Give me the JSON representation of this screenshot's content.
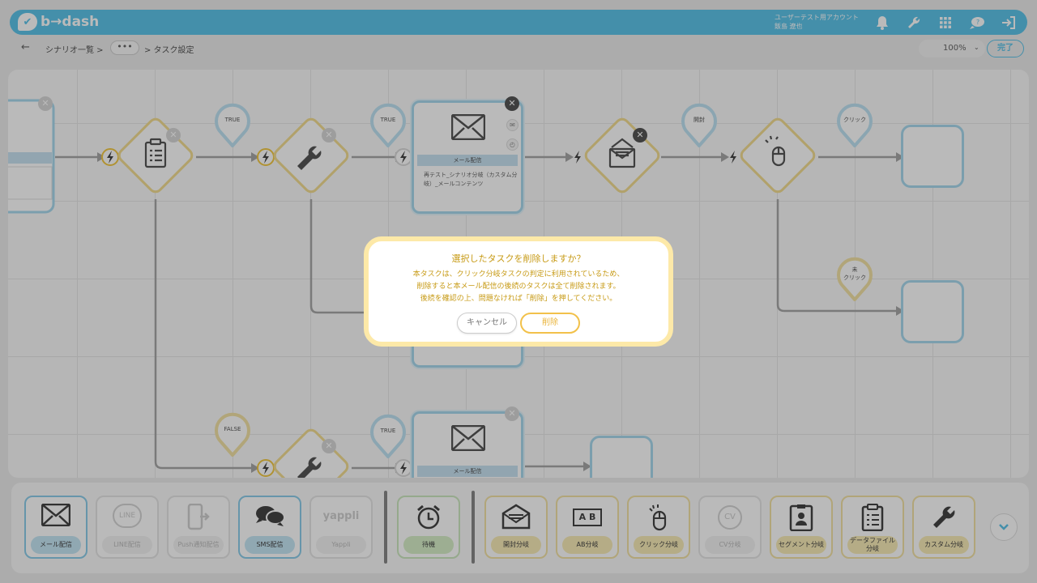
{
  "header": {
    "logo_text": "b→dash",
    "account_name": "ユーザーテスト用アカウント",
    "user_name": "飯島 遼也",
    "icons": [
      "bell-icon",
      "wrench-icon",
      "apps-grid-icon",
      "chat-icon",
      "logout-icon"
    ]
  },
  "breadcrumb": {
    "back": "←",
    "scenario_list": "シナリオ一覧 >",
    "more": "•••",
    "current": "> タスク設定"
  },
  "toolbar": {
    "zoom_value": "100%",
    "done_label": "完了"
  },
  "canvas": {
    "node1": {
      "label": "メール配信",
      "text": "再テスト_シナリオ分岐（カスタム分岐）_メールコンテンツ"
    },
    "node2": {
      "label": "メール配信"
    },
    "pins": {
      "true1": "TRUE",
      "true2": "TRUE",
      "open": "開封",
      "click": "クリック",
      "no_click_1": "未",
      "no_click_2": "クリック",
      "false": "FALSE",
      "true3": "TRUE"
    }
  },
  "palette": {
    "items": [
      {
        "label": "メール配信",
        "icon": "mail-icon",
        "state": "active"
      },
      {
        "label": "LINE配信",
        "icon": "line-icon",
        "state": "disabled"
      },
      {
        "label": "Push通知配信",
        "icon": "push-icon",
        "state": "disabled"
      },
      {
        "label": "SMS配信",
        "icon": "sms-icon",
        "state": "active"
      },
      {
        "label": "Yappli",
        "icon": "yappli-icon",
        "state": "disabled"
      },
      {
        "label": "待機",
        "icon": "alarm-clock-icon",
        "state": "active"
      },
      {
        "label": "開封分岐",
        "icon": "open-mail-icon",
        "state": "active"
      },
      {
        "label": "AB分岐",
        "icon": "ab-icon",
        "state": "active"
      },
      {
        "label": "クリック分岐",
        "icon": "mouse-icon",
        "state": "active"
      },
      {
        "label": "CV分岐",
        "icon": "cv-icon",
        "state": "disabled"
      },
      {
        "label": "セグメント分岐",
        "icon": "badge-icon",
        "state": "active"
      },
      {
        "label": "データファイル分岐",
        "icon": "clipboard-icon",
        "state": "active"
      },
      {
        "label": "カスタム分岐",
        "icon": "wrench-icon",
        "state": "active"
      }
    ],
    "yappli_logo": "yappli",
    "line_logo": "LINE",
    "ab_logo": "A B",
    "cv_logo": "CV"
  },
  "dialog": {
    "title": "選択したタスクを削除しますか？",
    "line1": "本タスクは、クリック分岐タスクの判定に利用されているため、",
    "line2": "削除すると本メール配信の後続のタスクは全て削除されます。",
    "line3": "後続を確認の上、問題なければ「削除」を押してください。",
    "cancel": "キャンセル",
    "delete": "削除"
  },
  "colors": {
    "brand": "#5ec4ea",
    "dialog_accent": "#c79a14",
    "dialog_border": "#fde9a8"
  }
}
